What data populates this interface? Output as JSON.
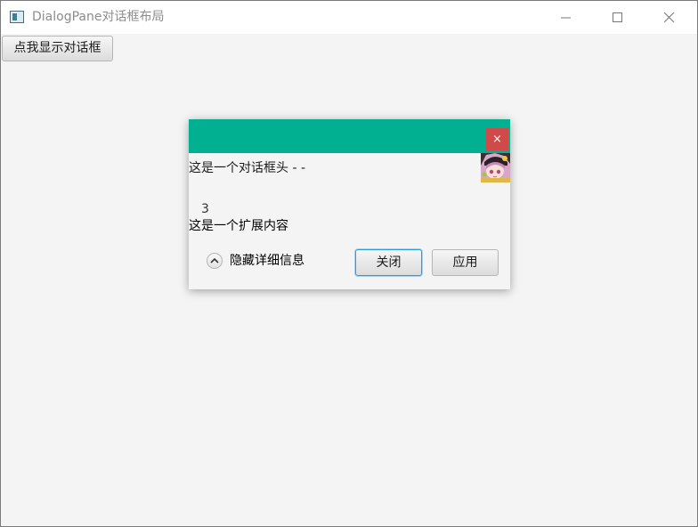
{
  "window": {
    "title": "DialogPane对话框布局"
  },
  "main": {
    "show_button_label": "点我显示对话框"
  },
  "dialog": {
    "header_bar_color": "#00b090",
    "close_button_glyph": "×",
    "close_button_color": "#d04a4a",
    "header_text": "这是一个对话框头 - -",
    "content_text": "3",
    "expandable_text": "这是一个扩展内容",
    "details_toggle_label": "隐藏详细信息",
    "details_expanded": true,
    "buttons": {
      "close_label": "关闭",
      "apply_label": "应用"
    },
    "default_button_focus_color": "#2a9ce0"
  },
  "icons": {
    "app": "app-window-icon",
    "minimize": "minimize-icon",
    "maximize": "maximize-icon",
    "close": "close-icon",
    "details": "chevron-up-icon",
    "header_graphic": "avatar-image"
  }
}
